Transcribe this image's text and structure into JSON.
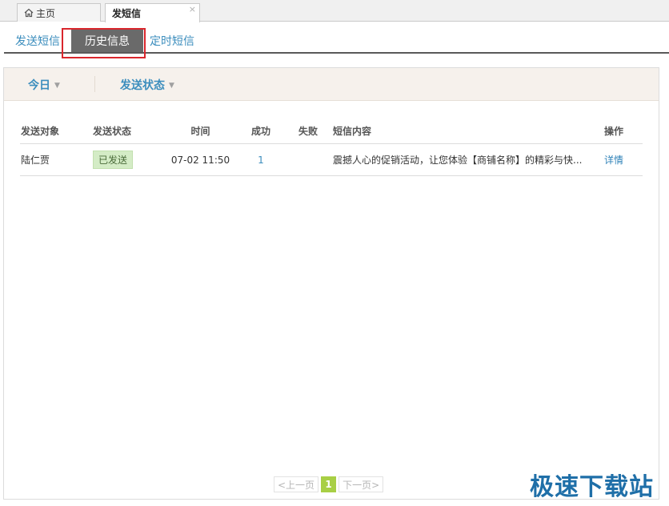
{
  "window_tabs": {
    "home_label": "主页",
    "active_label": "发短信",
    "close_glyph": "×"
  },
  "sub_tabs": [
    {
      "label": "发送短信",
      "active": false
    },
    {
      "label": "历史信息",
      "active": true
    },
    {
      "label": "定时短信",
      "active": false
    }
  ],
  "filters": {
    "date_label": "今日",
    "status_label": "发送状态"
  },
  "table": {
    "headers": [
      "发送对象",
      "发送状态",
      "时间",
      "成功",
      "失败",
      "短信内容",
      "操作"
    ],
    "rows": [
      {
        "recipient": "陆仁贾",
        "status": "已发送",
        "time": "07-02 11:50",
        "success": "1",
        "failed": "",
        "content": "震撼人心的促销活动，让您体验【商铺名称】的精彩与快...",
        "action": "详情"
      }
    ]
  },
  "pagination": {
    "prev_label": "<上一页",
    "current_page": "1",
    "next_label": "下一页>"
  },
  "watermark": "极速下载站",
  "colors": {
    "accent_blue": "#3b8dbd",
    "status_green_bg": "#d4ecc6",
    "page_current": "#a8cf45",
    "highlight_red": "#d9262c",
    "active_tab_bg": "#6a6a6a"
  }
}
